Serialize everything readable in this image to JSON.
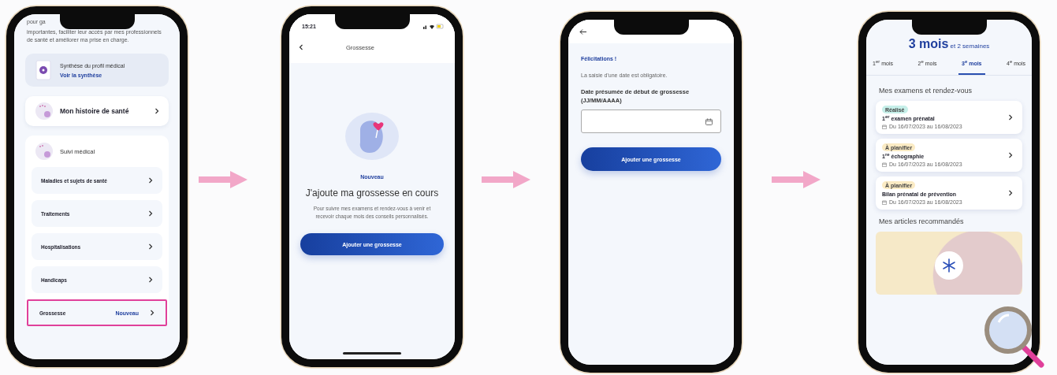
{
  "screens": [
    {
      "kind": "profile",
      "intro_fragment": "pour ga",
      "intro": "importantes, faciliter leur accès par mes professionnels de santé et améliorer ma prise en charge.",
      "summary": {
        "title": "Synthèse du profil médical",
        "link": "Voir la synthèse"
      },
      "history": {
        "label": "Mon histoire de santé"
      },
      "followup": {
        "title": "Suivi médical",
        "items": [
          {
            "label": "Maladies et sujets de santé",
            "highlighted": false
          },
          {
            "label": "Traitements",
            "highlighted": false
          },
          {
            "label": "Hospitalisations",
            "highlighted": false
          },
          {
            "label": "Handicaps",
            "highlighted": false
          },
          {
            "label": "Grossesse",
            "badge": "Nouveau",
            "highlighted": true
          }
        ]
      }
    },
    {
      "kind": "intro",
      "time": "15:21",
      "title": "Grossesse",
      "badge": "Nouveau",
      "heading": "J'ajoute ma grossesse en cours",
      "text": "Pour suivre mes examens et rendez-vous à venir et recevoir chaque mois des conseils personnalisés.",
      "button": "Ajouter une grossesse"
    },
    {
      "kind": "form",
      "greeting": "Félicitations !",
      "note": "La saisie d'une date est obligatoire.",
      "label": "Date présumée de début de grossesse (JJ/MM/AAAA)",
      "button": "Ajouter une grossesse"
    },
    {
      "kind": "timeline",
      "headline": "3 mois",
      "subline": "et 2 semaines",
      "tabs": [
        {
          "label": "1$^{er}$ mois",
          "selected": false
        },
        {
          "label": "2$^{e}$ mois",
          "selected": false
        },
        {
          "label": "3$^{e}$ mois",
          "selected": true
        },
        {
          "label": "4$^{e}$ mois",
          "selected": false
        }
      ],
      "section": "Mes examens et rendez-vous",
      "exams": [
        {
          "tag": "Réalisé",
          "color": "#c6efe9",
          "title": "1$^{er}$ examen prénatal",
          "dates": "Du 16/07/2023 au 16/08/2023"
        },
        {
          "tag": "À planifier",
          "color": "#fbebc4",
          "title": "1$^{re}$ échographie",
          "dates": "Du 16/07/2023 au 16/08/2023"
        },
        {
          "tag": "À planifier",
          "color": "#fbebc4",
          "title": "Bilan prénatal de prévention",
          "dates": "Du 16/07/2023 au 16/08/2023"
        }
      ],
      "articles": "Mes articles recommandés"
    }
  ]
}
